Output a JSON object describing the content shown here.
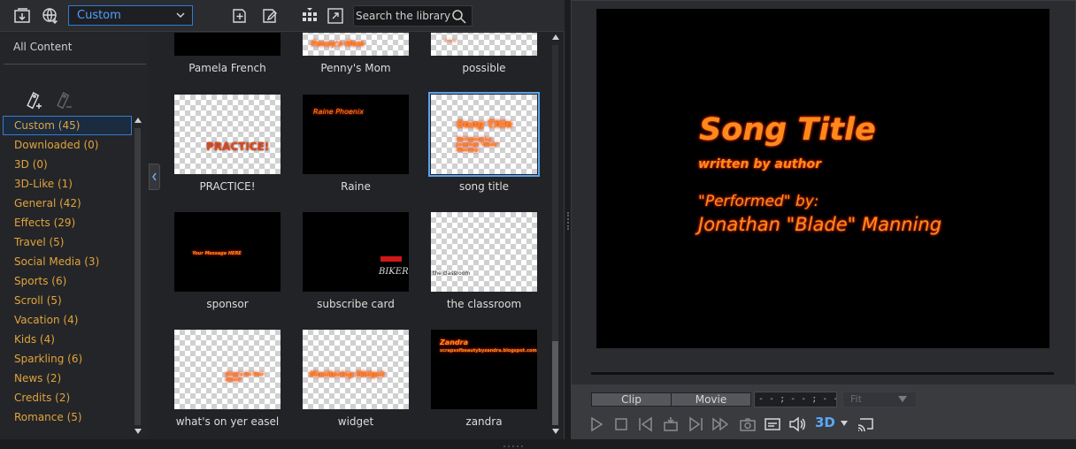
{
  "toolbar": {
    "category_value": "Custom",
    "search_placeholder": "Search the library"
  },
  "sidebar": {
    "all_content_label": "All Content",
    "categories": [
      {
        "label": "Custom  (45)"
      },
      {
        "label": "Downloaded  (0)"
      },
      {
        "label": "3D  (0)"
      },
      {
        "label": "3D-Like  (1)"
      },
      {
        "label": "General  (42)"
      },
      {
        "label": "Effects  (29)"
      },
      {
        "label": "Travel  (5)"
      },
      {
        "label": "Social Media  (3)"
      },
      {
        "label": "Sports  (6)"
      },
      {
        "label": "Scroll  (5)"
      },
      {
        "label": "Vacation  (4)"
      },
      {
        "label": "Kids  (4)"
      },
      {
        "label": "Sparkling  (6)"
      },
      {
        "label": "News  (2)"
      },
      {
        "label": "Credits  (2)"
      },
      {
        "label": "Romance  (5)"
      }
    ],
    "selected_index": 0
  },
  "library": {
    "items": [
      {
        "label": "Pamela French",
        "thumb_text": ""
      },
      {
        "label": "Penny's Mom",
        "thumb_text": "Penny's Mom"
      },
      {
        "label": "possible",
        "thumb_text": ""
      },
      {
        "label": "PRACTICE!",
        "thumb_text": "PRACTICE!"
      },
      {
        "label": "Raine",
        "thumb_text": "Raine Phoenix"
      },
      {
        "label": "song title",
        "thumb_text": "Song Title",
        "thumb_sub": "Performed by: Jonathan \"Blade\" Manning",
        "selected": true
      },
      {
        "label": "sponsor",
        "thumb_text": "Your Message HERE"
      },
      {
        "label": "subscribe card",
        "thumb_text": "BIKER"
      },
      {
        "label": "the classroom",
        "thumb_text": "the classroom"
      },
      {
        "label": "what's on yer easel",
        "thumb_text": "What's On Your Easel?"
      },
      {
        "label": "widget",
        "thumb_text": "Monitoring Widget"
      },
      {
        "label": "zandra",
        "thumb_text": "Zandra",
        "thumb_sub": "scrapsofbeautybyzandra.blogspot.com"
      }
    ]
  },
  "preview": {
    "title": "Song Title",
    "author": "written by author",
    "performed": "\"Performed\" by:",
    "performer": "Jonathan \"Blade\" Manning",
    "mode_clip": "Clip",
    "mode_movie": "Movie",
    "timecode": "- - ; - - ; - - ; - -",
    "fit": "Fit",
    "stereo_label": "3D"
  },
  "colors": {
    "accent_blue": "#2f7bd6",
    "category_text": "#e0a43c",
    "title_fire": "#ff8a1c"
  }
}
